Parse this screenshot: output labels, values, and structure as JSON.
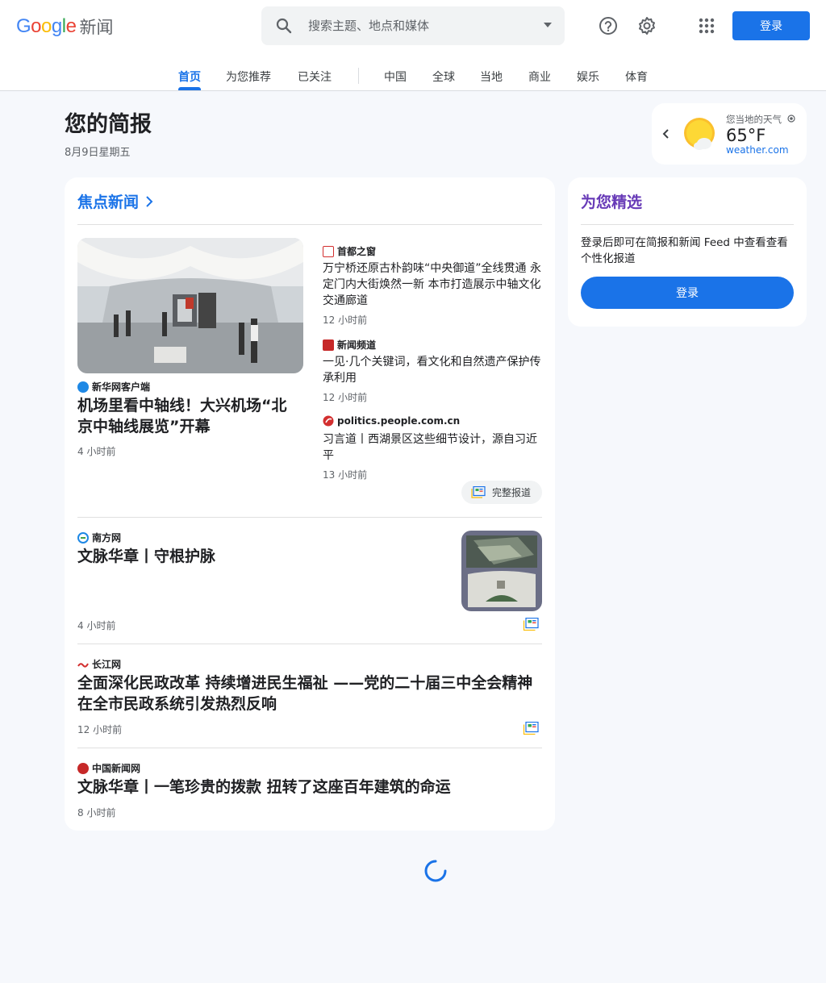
{
  "header": {
    "logo_google": "Google",
    "logo_news": "新闻",
    "search_placeholder": "搜索主题、地点和媒体",
    "login_label": "登录",
    "icons": [
      "help-icon",
      "settings-icon",
      "apps-grid-icon",
      "search-icon"
    ]
  },
  "tabs": [
    {
      "label": "首页",
      "active": true
    },
    {
      "label": "为您推荐"
    },
    {
      "label": "已关注"
    },
    {
      "label": "中国"
    },
    {
      "label": "全球"
    },
    {
      "label": "当地"
    },
    {
      "label": "商业"
    },
    {
      "label": "娱乐"
    },
    {
      "label": "体育"
    }
  ],
  "briefing": {
    "title": "您的简报",
    "date": "8月9日星期五"
  },
  "weather": {
    "label": "您当地的天气",
    "temp": "65°F",
    "source": "weather.com"
  },
  "top_stories": {
    "title": "焦点新闻",
    "main": {
      "source": "新华网客户端",
      "headline": "机场里看中轴线！大兴机场“北京中轴线展览”开幕",
      "time": "4 小时前"
    },
    "related": [
      {
        "source": "首都之窗",
        "headline": "万宁桥还原古朴韵味“中央御道”全线贯通 永定门内大街焕然一新 本市打造展示中轴文化交通廊道",
        "time": "12 小时前"
      },
      {
        "source": "新闻频道",
        "headline": "一见·几个关键词，看文化和自然遗产保护传承利用",
        "time": "12 小时前"
      },
      {
        "source": "politics.people.com.cn",
        "headline": "习言道丨西湖景区这些细节设计，源自习近平",
        "time": "13 小时前"
      }
    ],
    "full_coverage": "完整报道",
    "stories": [
      {
        "source": "南方网",
        "headline": "文脉华章丨守根护脉",
        "time": "4 小时前"
      },
      {
        "source": "长江网",
        "headline": "全面深化民政改革 持续增进民生福祉 ——党的二十届三中全会精神在全市民政系统引发热烈反响",
        "time": "12 小时前"
      },
      {
        "source": "中国新闻网",
        "headline": "文脉华章丨一笔珍贵的拨款 扭转了这座百年建筑的命运",
        "time": "8 小时前"
      }
    ]
  },
  "for_you": {
    "title": "为您精选",
    "text": "登录后即可在简报和新闻 Feed 中查看查看个性化报道",
    "button": "登录"
  },
  "colors": {
    "accent": "#1a73e8",
    "purple": "#673ab7",
    "background": "#f6f8fc"
  }
}
